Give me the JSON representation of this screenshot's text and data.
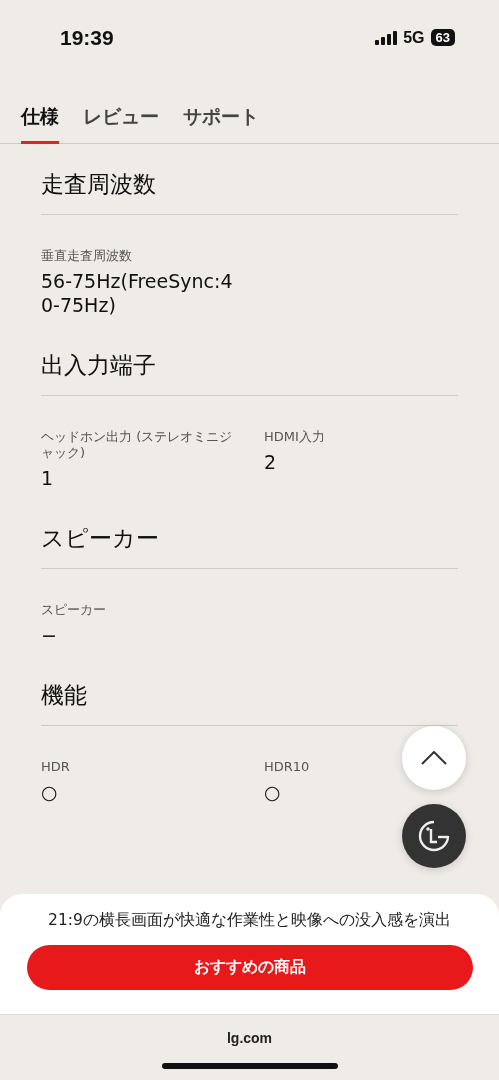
{
  "status_bar": {
    "time": "19:39",
    "network": "5G",
    "battery": "63"
  },
  "tabs": [
    {
      "label": "仕様",
      "selected": true
    },
    {
      "label": "レビュー",
      "selected": false
    },
    {
      "label": "サポート",
      "selected": false
    }
  ],
  "sections": [
    {
      "title": "走査周波数",
      "specs": [
        {
          "label": "垂直走査周波数",
          "value": "56-75Hz(FreeSync:40-75Hz)"
        }
      ]
    },
    {
      "title": "出入力端子",
      "specs": [
        {
          "label": "ヘッドホン出力 (ステレオミニジャック)",
          "value": "1"
        },
        {
          "label": "HDMI入力",
          "value": "2"
        }
      ]
    },
    {
      "title": "スピーカー",
      "specs": [
        {
          "label": "スピーカー",
          "value": "−"
        }
      ]
    },
    {
      "title": "機能",
      "specs": [
        {
          "label": "HDR",
          "value": "○"
        },
        {
          "label": "HDR10",
          "value": "○"
        }
      ]
    }
  ],
  "promo": {
    "text": "21:9の横長画面が快適な作業性と映像への没入感を演出",
    "button": "おすすめの商品"
  },
  "url": "lg.com"
}
